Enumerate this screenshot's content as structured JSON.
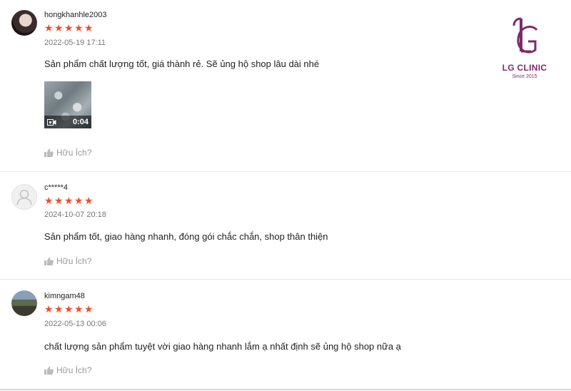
{
  "reviews": [
    {
      "username": "hongkhanhle2003",
      "rating": 5,
      "stars": "★★★★★",
      "datetime": "2022-05-19 17:11",
      "comment": "Sản phẩm chất lượng tốt, giá thành rẻ. Sẽ ủng hộ shop lâu dài nhé",
      "video_duration": "0:04",
      "helpful_label": "Hữu Ích?"
    },
    {
      "username": "c*****4",
      "rating": 5,
      "stars": "★★★★★",
      "datetime": "2024-10-07 20:18",
      "comment": "Sản phẩm tốt, giao hàng nhanh, đóng gói chắc chắn, shop thân thiện",
      "helpful_label": "Hữu Ích?"
    },
    {
      "username": "kimngam48",
      "rating": 5,
      "stars": "★★★★★",
      "datetime": "2022-05-13 00:06",
      "comment": "chất lượng sản phẩm tuyệt vời giao hàng nhanh lắm ạ nhất định sẽ ủng hộ shop nữa ạ",
      "helpful_label": "Hữu Ích?"
    }
  ],
  "logo": {
    "brand": "LG CLINIC",
    "tagline": "Since 2015",
    "color": "#7b2a6e"
  },
  "colors": {
    "star": "#ee4d2d",
    "muted": "#999999",
    "date": "#777777"
  }
}
